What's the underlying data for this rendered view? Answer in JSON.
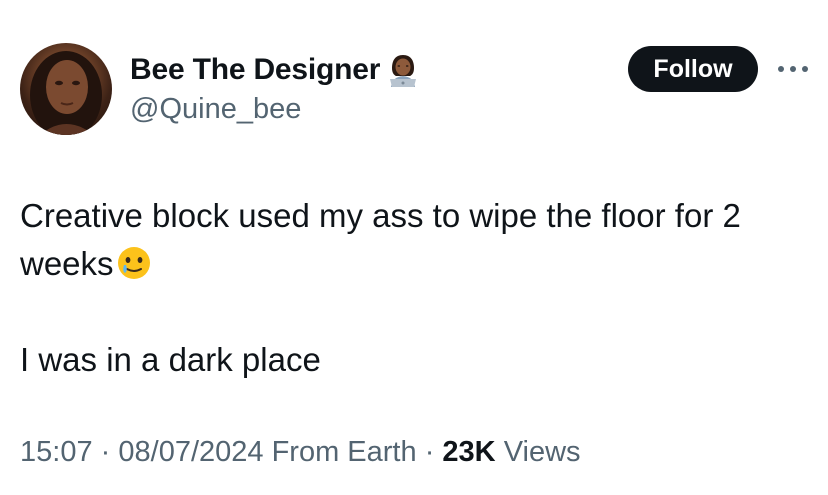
{
  "author": {
    "display_name": "Bee The Designer",
    "handle": "@Quine_bee",
    "avatar_icon": "profile-photo",
    "name_badge_icon": "woman-technologist-emoji"
  },
  "actions": {
    "follow_label": "Follow",
    "more_icon": "more-dots-icon"
  },
  "tweet": {
    "line1": "Creative block used my ass to wipe the floor for 2 weeks",
    "line1_emoji": "face-holding-back-tears-emoji",
    "line2": "I was in a dark place"
  },
  "meta": {
    "time": "15:07",
    "date": "08/07/2024",
    "source": "From Earth",
    "separator": "·",
    "views_count": "23K",
    "views_label": "Views"
  },
  "colors": {
    "text_primary": "#0f1419",
    "text_secondary": "#536471",
    "follow_bg": "#0f1419",
    "background": "#ffffff"
  }
}
